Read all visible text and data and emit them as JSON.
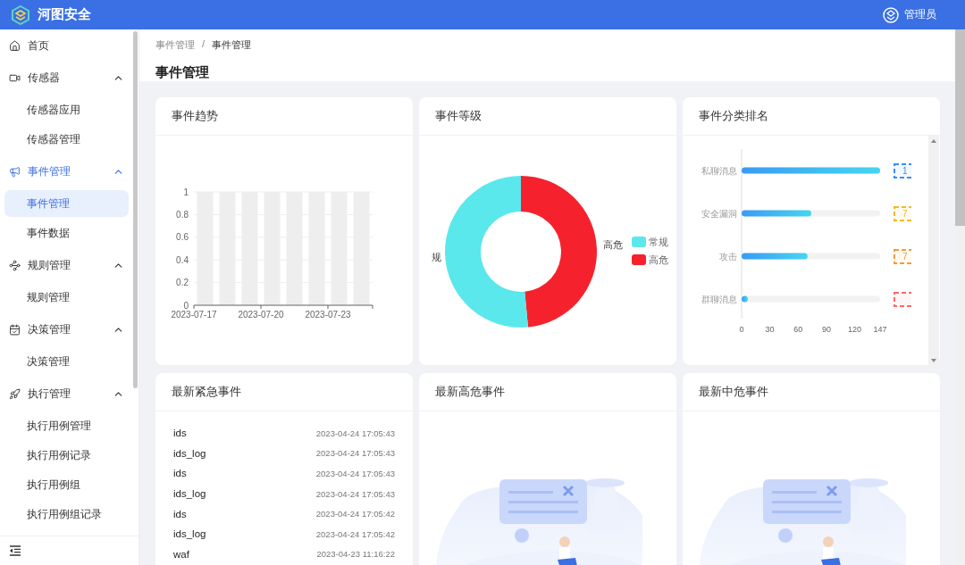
{
  "header": {
    "title": "河图安全",
    "user": "管理员"
  },
  "sidebar": {
    "items": [
      {
        "label": "首页",
        "selected": false
      },
      {
        "label": "传感器",
        "selected": false,
        "expanded": true,
        "children": [
          {
            "label": "传感器应用",
            "selected": false
          },
          {
            "label": "传感器管理",
            "selected": false
          }
        ]
      },
      {
        "label": "事件管理",
        "selected": true,
        "expanded": true,
        "children": [
          {
            "label": "事件管理",
            "selected": true
          },
          {
            "label": "事件数据",
            "selected": false
          }
        ]
      },
      {
        "label": "规则管理",
        "selected": false,
        "expanded": true,
        "children": [
          {
            "label": "规则管理",
            "selected": false
          }
        ]
      },
      {
        "label": "决策管理",
        "selected": false,
        "expanded": true,
        "children": [
          {
            "label": "决策管理",
            "selected": false
          }
        ]
      },
      {
        "label": "执行管理",
        "selected": false,
        "expanded": true,
        "children": [
          {
            "label": "执行用例管理",
            "selected": false
          },
          {
            "label": "执行用例记录",
            "selected": false
          },
          {
            "label": "执行用例组",
            "selected": false
          },
          {
            "label": "执行用例组记录",
            "selected": false
          }
        ]
      }
    ]
  },
  "breadcrumb": [
    "事件管理",
    "事件管理"
  ],
  "breadcrumb_separator": "/",
  "page_title": "事件管理",
  "cards": [
    {
      "kind": "trend",
      "title": "事件趋势",
      "chart_data": {
        "type": "bar",
        "categories": [
          "2023-07-17",
          null,
          null,
          "2023-07-20",
          null,
          null,
          "2023-07-23",
          null
        ],
        "series": [
          {
            "color": "#eeeeee",
            "values": [
              1,
              1,
              1,
              1,
              1,
              1,
              1,
              1
            ]
          }
        ],
        "ylim": [
          0,
          1
        ],
        "yticks": [
          0,
          0.2,
          0.4,
          0.6,
          0.8,
          1
        ],
        "grid": true
      }
    },
    {
      "kind": "level",
      "title": "事件等级",
      "chart_data": {
        "type": "donut",
        "categories": [
          "常规",
          "高危"
        ],
        "values": [
          51.5,
          48.5
        ],
        "colors": [
          "#5ae8ec",
          "#f5222d"
        ],
        "value_labels": [
          "规",
          "高危"
        ],
        "legend": "right"
      }
    },
    {
      "kind": "ranking",
      "title": "事件分类排名",
      "chart_data": {
        "type": "bar",
        "orientation": "horizontal",
        "categories": [
          "私聊消息",
          "安全漏洞",
          "攻击",
          "群聊消息"
        ],
        "values": [
          147,
          74,
          70,
          6
        ],
        "xlim": [
          0,
          147
        ],
        "xticks": [
          0,
          30,
          60,
          90,
          120,
          147
        ]
      },
      "tags": [
        {
          "text": "1",
          "color": "#3a8ef5"
        },
        {
          "text": "7",
          "color": "#f5b922"
        },
        {
          "text": "7",
          "color": "#f59a3a"
        },
        {
          "color": "#f56c6c"
        }
      ]
    },
    {
      "kind": "list",
      "title": "最新紧急事件",
      "rows": [
        {
          "name": "ids",
          "time": "2023-04-24 17:05:43"
        },
        {
          "name": "ids_log",
          "time": "2023-04-24 17:05:43"
        },
        {
          "name": "ids",
          "time": "2023-04-24 17:05:43"
        },
        {
          "name": "ids_log",
          "time": "2023-04-24 17:05:43"
        },
        {
          "name": "ids",
          "time": "2023-04-24 17:05:42"
        },
        {
          "name": "ids_log",
          "time": "2023-04-24 17:05:42"
        },
        {
          "name": "waf",
          "time": "2023-04-23 11:16:22"
        }
      ]
    },
    {
      "kind": "empty",
      "title": "最新高危事件"
    },
    {
      "kind": "empty",
      "title": "最新中危事件"
    }
  ]
}
